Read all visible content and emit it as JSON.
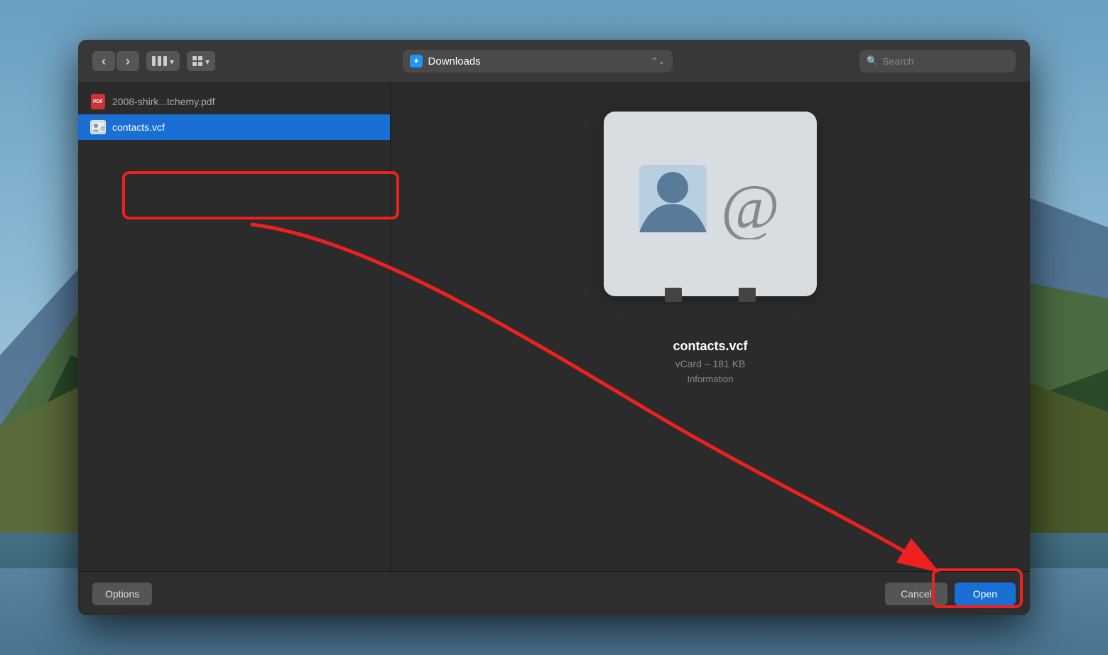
{
  "desktop": {
    "bg_description": "macOS Big Sur mountain landscape"
  },
  "dialog": {
    "title": "Open File Dialog"
  },
  "toolbar": {
    "back_label": "‹",
    "forward_label": "›",
    "view_columns_label": "Columns",
    "view_grid_label": "Grid",
    "location": "Downloads",
    "search_placeholder": "Search"
  },
  "file_list": {
    "items": [
      {
        "name": "2008-shirk...tchemy.pdf",
        "type": "pdf",
        "selected": false
      },
      {
        "name": "contacts.vcf",
        "type": "vcf",
        "selected": true
      }
    ]
  },
  "preview": {
    "file_name": "contacts.vcf",
    "file_type_size": "vCard – 181 KB",
    "info_label": "Information"
  },
  "bottom_bar": {
    "options_label": "Options",
    "cancel_label": "Cancel",
    "open_label": "Open"
  },
  "annotations": {
    "red_outline_color": "#ee2020",
    "arrow_color": "#ee2020"
  }
}
